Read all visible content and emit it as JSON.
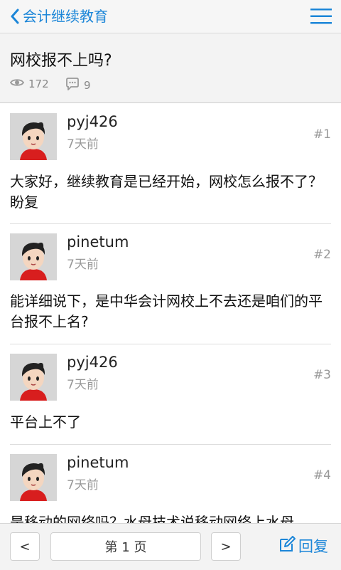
{
  "nav": {
    "back_label": "会计继续教育"
  },
  "thread": {
    "title": "网校报不上吗?",
    "views": "172",
    "replies": "9"
  },
  "posts": [
    {
      "author": "pyj426",
      "time": "7天前",
      "floor": "#1",
      "content": "大家好，继续教育是已经开始，网校怎么报不了？盼复"
    },
    {
      "author": "pinetum",
      "time": "7天前",
      "floor": "#2",
      "content": "能详细说下，是中华会计网校上不去还是咱们的平台报不上名?"
    },
    {
      "author": "pyj426",
      "time": "7天前",
      "floor": "#3",
      "content": "平台上不了"
    },
    {
      "author": "pinetum",
      "time": "7天前",
      "floor": "#4",
      "content": "是移动的网络吗？水母技术说移动网络上水母"
    }
  ],
  "pager": {
    "prev": "<",
    "current": "第 1 页",
    "next": ">"
  },
  "reply": {
    "label": "回复"
  },
  "colors": {
    "accent": "#1c86d8"
  }
}
